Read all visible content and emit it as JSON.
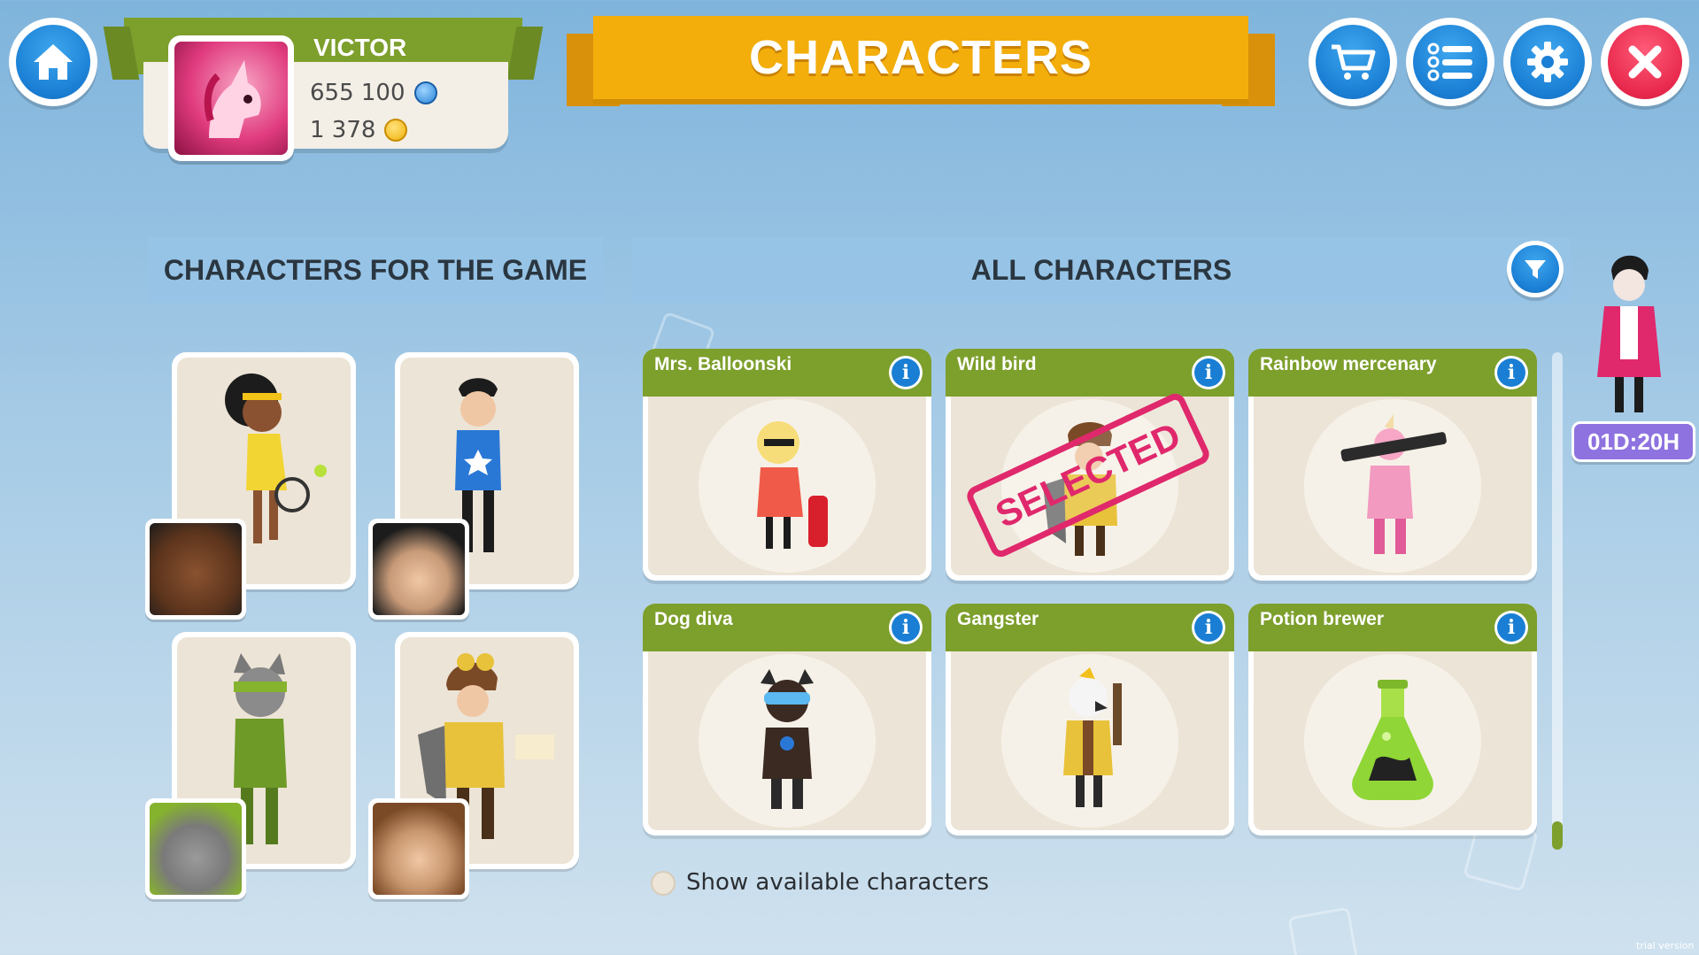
{
  "player": {
    "name": "VICTOR",
    "gems": "655 100",
    "coins": "1 378"
  },
  "title": "CHARACTERS",
  "sections": {
    "game_characters": "CHARACTERS FOR THE GAME",
    "all_characters": "ALL CHARACTERS"
  },
  "characters": [
    {
      "name": "Mrs. Balloonski",
      "selected": false
    },
    {
      "name": "Wild bird",
      "selected": true
    },
    {
      "name": "Rainbow mercenary",
      "selected": false
    },
    {
      "name": "Dog diva",
      "selected": false
    },
    {
      "name": "Gangster",
      "selected": false
    },
    {
      "name": "Potion brewer",
      "selected": false
    }
  ],
  "selected_stamp": "SELECTED",
  "info_glyph": "i",
  "show_available_label": "Show available characters",
  "timer": "01D:20H",
  "watermark": "trial version",
  "colors": {
    "accent_green": "#7d9f2c",
    "banner_yellow": "#f3ae0b",
    "button_blue": "#1a7fd4",
    "close_red": "#e8294d",
    "stamp_pink": "#e0286c",
    "timer_purple": "#8e72e0"
  },
  "icons": [
    "home-icon",
    "cart-icon",
    "tasks-icon",
    "gear-icon",
    "close-icon",
    "filter-icon",
    "info-icon",
    "gem-icon",
    "coin-icon"
  ]
}
